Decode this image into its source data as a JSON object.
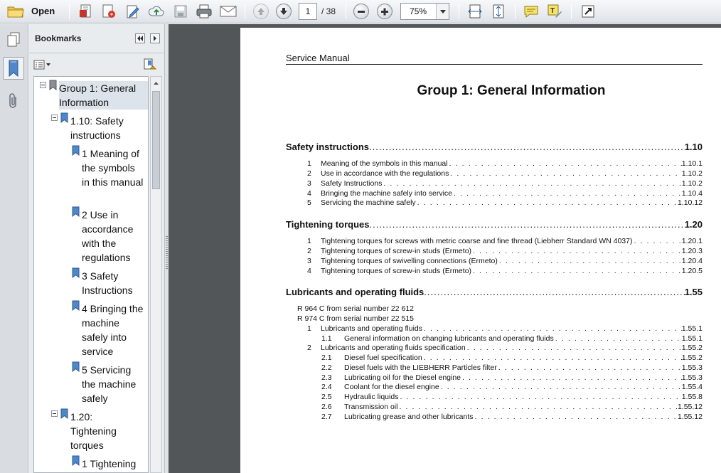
{
  "toolbar": {
    "open_label": "Open",
    "page_current": "1",
    "page_total": "/ 38",
    "zoom": "75%"
  },
  "bookmarks": {
    "title": "Bookmarks",
    "items": [
      {
        "label": "Group 1: General Information"
      },
      {
        "label": "1.10: Safety instructions"
      },
      {
        "label": "1 Meaning of the symbols in this manual"
      },
      {
        "label": "2 Use in accordance with the regulations"
      },
      {
        "label": "3 Safety Instructions"
      },
      {
        "label": "4 Bringing the machine safely into service"
      },
      {
        "label": "5 Servicing the machine safely"
      },
      {
        "label": "1.20: Tightening torques"
      },
      {
        "label": "1 Tightening"
      }
    ]
  },
  "document": {
    "running_head": "Service Manual",
    "title": "Group 1: General Information",
    "sections": [
      {
        "title": "Safety instructions",
        "page": "1.10",
        "entries": [
          {
            "num": "1",
            "text": "Meaning of the symbols in this manual",
            "page": "1.10.1"
          },
          {
            "num": "2",
            "text": "Use in accordance with the regulations",
            "page": "1.10.2"
          },
          {
            "num": "3",
            "text": "Safety Instructions",
            "page": "1.10.2"
          },
          {
            "num": "4",
            "text": "Bringing the machine safely into service",
            "page": "1.10.4"
          },
          {
            "num": "5",
            "text": "Servicing the machine safely",
            "page": "1.10.12"
          }
        ]
      },
      {
        "title": "Tightening torques",
        "page": "1.20",
        "entries": [
          {
            "num": "1",
            "text": "Tightening torques for screws with metric coarse and fine thread (Liebherr Standard WN 4037)",
            "page": "1.20.1"
          },
          {
            "num": "2",
            "text": "Tightening torques of screw-in studs (Ermeto)",
            "page": "1.20.3"
          },
          {
            "num": "3",
            "text": "Tightening torques of swivelling connections (Ermeto)",
            "page": "1.20.4"
          },
          {
            "num": "4",
            "text": "Tightening torques of screw-in studs (Ermeto)",
            "page": "1.20.5"
          }
        ]
      },
      {
        "title": "Lubricants and operating fluids",
        "page": "1.55",
        "notes": [
          "R 964 C from serial number 22 612",
          "R 974 C from serial number 22 515"
        ],
        "entries": [
          {
            "num": "1",
            "text": "Lubricants and operating fluids",
            "page": "1.55.1"
          },
          {
            "num": "1.1",
            "text": "General information on changing lubricants and operating fluids",
            "page": "1.55.1"
          },
          {
            "num": "2",
            "text": "Lubricants and operating fluids specification",
            "page": "1.55.2"
          },
          {
            "num": "2.1",
            "text": "Diesel fuel specification",
            "page": "1.55.2"
          },
          {
            "num": "2.2",
            "text": "Diesel fuels with the LIEBHERR Particles filter",
            "page": "1.55.3"
          },
          {
            "num": "2.3",
            "text": "Lubricating oil for the Diesel engine",
            "page": "1.55.3"
          },
          {
            "num": "2.4",
            "text": "Coolant for the diesel engine",
            "page": "1.55.4"
          },
          {
            "num": "2.5",
            "text": "Hydraulic liquids",
            "page": "1.55.8"
          },
          {
            "num": "2.6",
            "text": "Transmission oil",
            "page": "1.55.12"
          },
          {
            "num": "2.7",
            "text": "Lubricating grease and other lubricants",
            "page": "1.55.12"
          }
        ]
      }
    ]
  }
}
